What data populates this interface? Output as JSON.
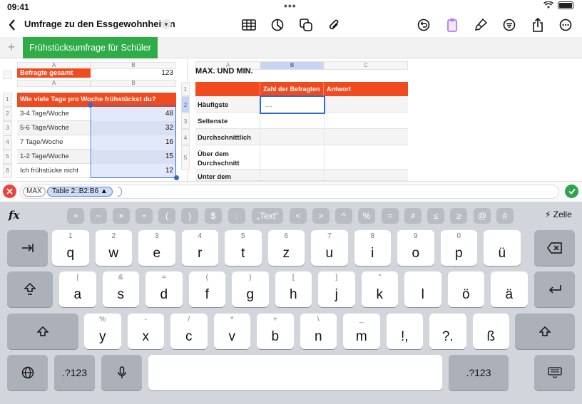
{
  "status": {
    "time": "09:41"
  },
  "toolbar": {
    "title": "Umfrage zu den Essgewohnheiten"
  },
  "sheet": {
    "tab_label": "Frühstücksumfrage für Schüler"
  },
  "table1": {
    "header_label": "Befragte gesamt",
    "header_value": "123",
    "col_a": "A",
    "col_b": "B",
    "question": "Wie viele Tage pro Woche frühstückst du?",
    "rows": [
      {
        "label": "3-4 Tage/Woche",
        "value": "48"
      },
      {
        "label": "5-6 Tage/Woche",
        "value": "32"
      },
      {
        "label": "7 Tage/Woche",
        "value": "16"
      },
      {
        "label": "1-2 Tage/Woche",
        "value": "15"
      },
      {
        "label": "Ich frühstücke nicht",
        "value": "12"
      }
    ],
    "row_numbers": [
      "1",
      "2",
      "3",
      "4",
      "5",
      "6"
    ]
  },
  "table2": {
    "title": "MAX. UND MIN.",
    "cols": [
      "A",
      "B",
      "C"
    ],
    "header_b": "Zahl der Befragten",
    "header_c": "Antwort",
    "row_numbers": [
      "1",
      "2",
      "3",
      "4",
      "5"
    ],
    "rows": [
      "Häufigste",
      "Seltenste",
      "Durchschnittlich",
      "Über dem Durchschnitt",
      "Unter dem"
    ],
    "selected_value": "…"
  },
  "formula": {
    "func": "MAX",
    "ref": "Table 2::B2:B6 ▲"
  },
  "keyboard": {
    "fx": "fx",
    "cell_label": "⚡ Zelle",
    "symbols": [
      "+",
      "−",
      "×",
      "÷",
      "(",
      ")",
      "$",
      ":",
      "„Text“",
      "<",
      ">",
      "^",
      "%",
      "=",
      "≠",
      "≤",
      "≥",
      "@",
      "#"
    ],
    "row1": [
      {
        "m": "q",
        "a": "1"
      },
      {
        "m": "w",
        "a": "2"
      },
      {
        "m": "e",
        "a": "3"
      },
      {
        "m": "r",
        "a": "4"
      },
      {
        "m": "t",
        "a": "5"
      },
      {
        "m": "z",
        "a": "6"
      },
      {
        "m": "u",
        "a": "7"
      },
      {
        "m": "i",
        "a": "8"
      },
      {
        "m": "o",
        "a": "9"
      },
      {
        "m": "p",
        "a": "0"
      },
      {
        "m": "ü",
        "a": ""
      }
    ],
    "row2": [
      {
        "m": "a",
        "a": "|"
      },
      {
        "m": "s",
        "a": "&"
      },
      {
        "m": "d",
        "a": "="
      },
      {
        "m": "f",
        "a": "("
      },
      {
        "m": "g",
        "a": ")"
      },
      {
        "m": "h",
        "a": "["
      },
      {
        "m": "j",
        "a": "]"
      },
      {
        "m": "k",
        "a": "\""
      },
      {
        "m": "l",
        "a": ""
      },
      {
        "m": "ö",
        "a": ""
      },
      {
        "m": "ä",
        "a": ""
      }
    ],
    "row3": [
      {
        "m": "y",
        "a": "%"
      },
      {
        "m": "x",
        "a": "-"
      },
      {
        "m": "c",
        "a": "/"
      },
      {
        "m": "v",
        "a": "*"
      },
      {
        "m": "b",
        "a": "+"
      },
      {
        "m": "n",
        "a": "\\"
      },
      {
        "m": "m",
        "a": "_"
      },
      {
        "m": "!,",
        "a": ""
      },
      {
        "m": "?.",
        "a": ""
      },
      {
        "m": "ß",
        "a": ""
      }
    ],
    "row2_alt_pairs": [
      "{ }",
      "< >",
      "[ ]"
    ],
    "num_label": ".?123"
  }
}
